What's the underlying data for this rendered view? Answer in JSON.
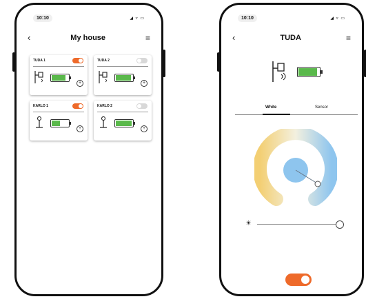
{
  "colors": {
    "accent": "#ee6a2a",
    "battery": "#5ab94b",
    "toggle_off": "#d8d8d8"
  },
  "phone1": {
    "status": {
      "time": "10:10",
      "icons": "◢ ▿ ▭"
    },
    "nav": {
      "back_icon": "chevron-left",
      "title": "My house",
      "menu_icon": "menu-lines"
    },
    "devices": [
      {
        "name": "TUDA 1",
        "on": true,
        "battery": 0.85,
        "icon": "wall-lamp-icon"
      },
      {
        "name": "TUDA 2",
        "on": false,
        "battery": 0.9,
        "icon": "wall-lamp-icon"
      },
      {
        "name": "KARLO 1",
        "on": true,
        "battery": 0.5,
        "icon": "floor-lamp-icon"
      },
      {
        "name": "KARLO 2",
        "on": false,
        "battery": 0.95,
        "icon": "floor-lamp-icon"
      }
    ]
  },
  "phone2": {
    "status": {
      "time": "10:10",
      "icons": "◢ ▿ ▭"
    },
    "nav": {
      "back_icon": "chevron-left",
      "title": "TUDA",
      "menu_icon": "menu-lines"
    },
    "device_icon": "wall-lamp-signal-icon",
    "battery": 0.9,
    "tabs": [
      {
        "label": "White",
        "active": true
      },
      {
        "label": "Sensor",
        "active": false
      }
    ],
    "color_temp_level": 0.9,
    "brightness": 1.0,
    "power_on": true
  }
}
